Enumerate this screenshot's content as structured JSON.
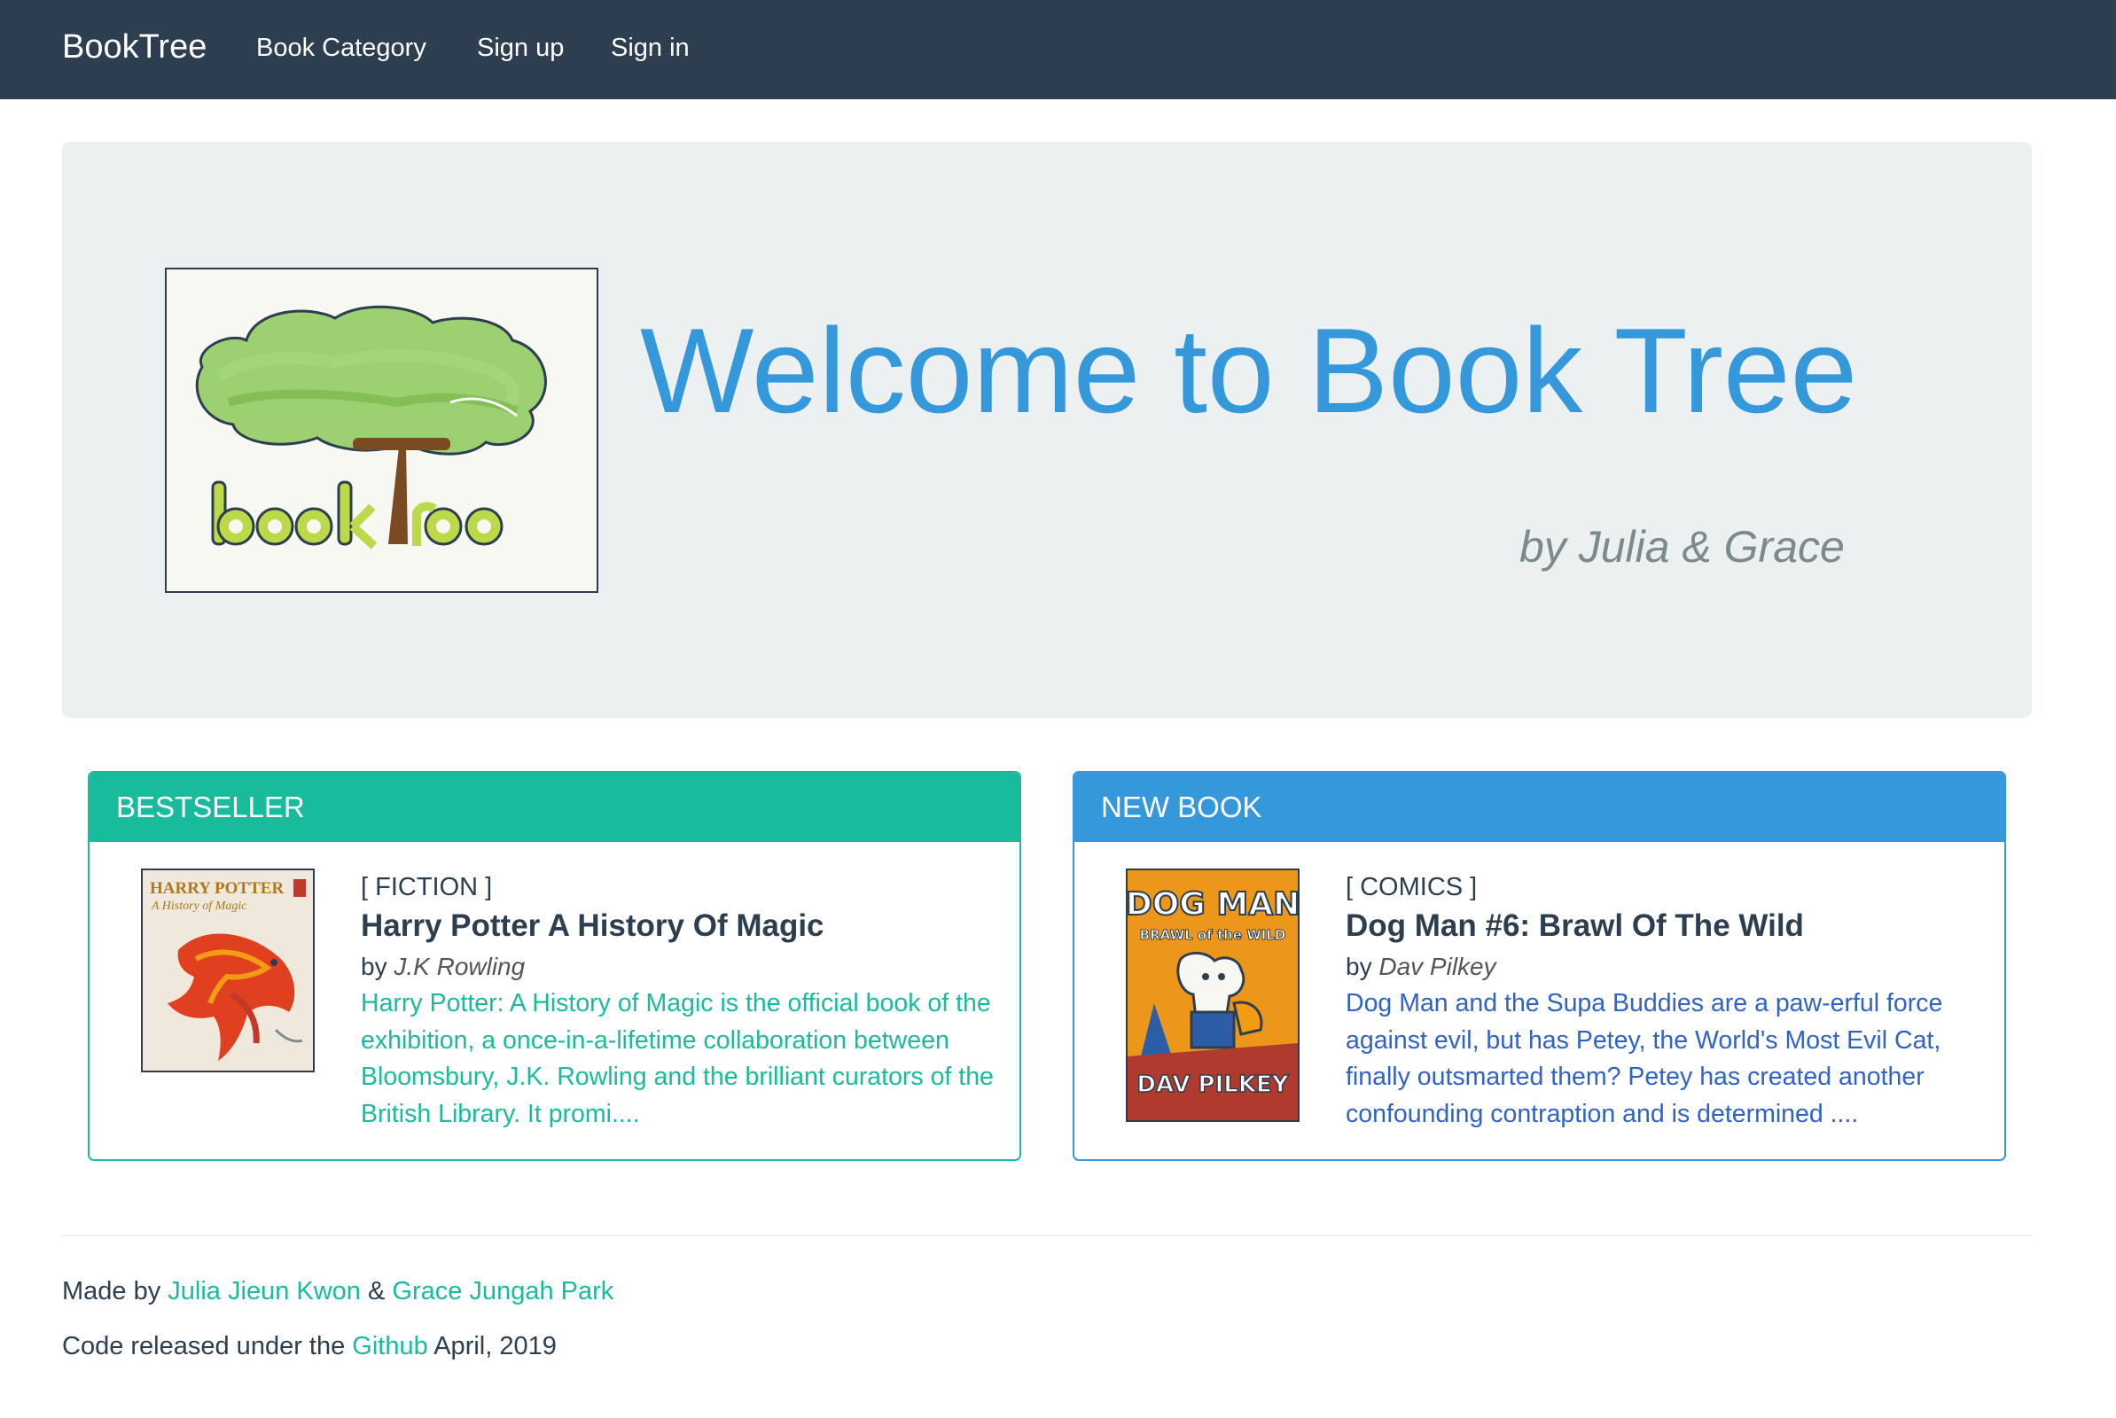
{
  "navbar": {
    "brand": "BookTree",
    "links": [
      "Book Category",
      "Sign up",
      "Sign in"
    ]
  },
  "jumbotron": {
    "logo_text": "bookTree",
    "title": "Welcome to Book Tree",
    "byline": "by Julia & Grace"
  },
  "bestseller": {
    "header": "BESTSELLER",
    "genre": "[ FICTION ]",
    "title": "Harry Potter A History Of Magic",
    "by": "by",
    "author": "J.K Rowling",
    "description": "Harry Potter: A History of Magic is the official book of the exhibition, a once-in-a-lifetime collaboration between Bloomsbury, J.K. Rowling and the brilliant curators of the British Library. It promi....",
    "cover_text": {
      "series": "HARRY POTTER",
      "subtitle": "A History of Magic"
    }
  },
  "new_book": {
    "header": "NEW BOOK",
    "genre": "[ COMICS ]",
    "title": "Dog Man #6: Brawl Of The Wild",
    "by": "by",
    "author": "Dav Pilkey",
    "description": "Dog Man and the Supa Buddies are a paw-erful force against evil, but has Petey, the World's Most Evil Cat, finally outsmarted them? Petey has created another confounding contraption and is determined ....",
    "cover_text": {
      "series": "DOG MAN",
      "subtitle": "BRAWL of the WILD",
      "author": "DAV PILKEY"
    }
  },
  "footer": {
    "made_by": "Made by",
    "author1": "Julia Jieun Kwon",
    "amp": "&",
    "author2": "Grace Jungah Park",
    "released": "Code released under the",
    "github": "Github",
    "date": "April, 2019"
  },
  "colors": {
    "navbar": "#2c3e50",
    "jumbotron": "#ecf0f1",
    "primary": "#3498db",
    "success": "#18bc9c",
    "muted": "#7b8a8b"
  }
}
